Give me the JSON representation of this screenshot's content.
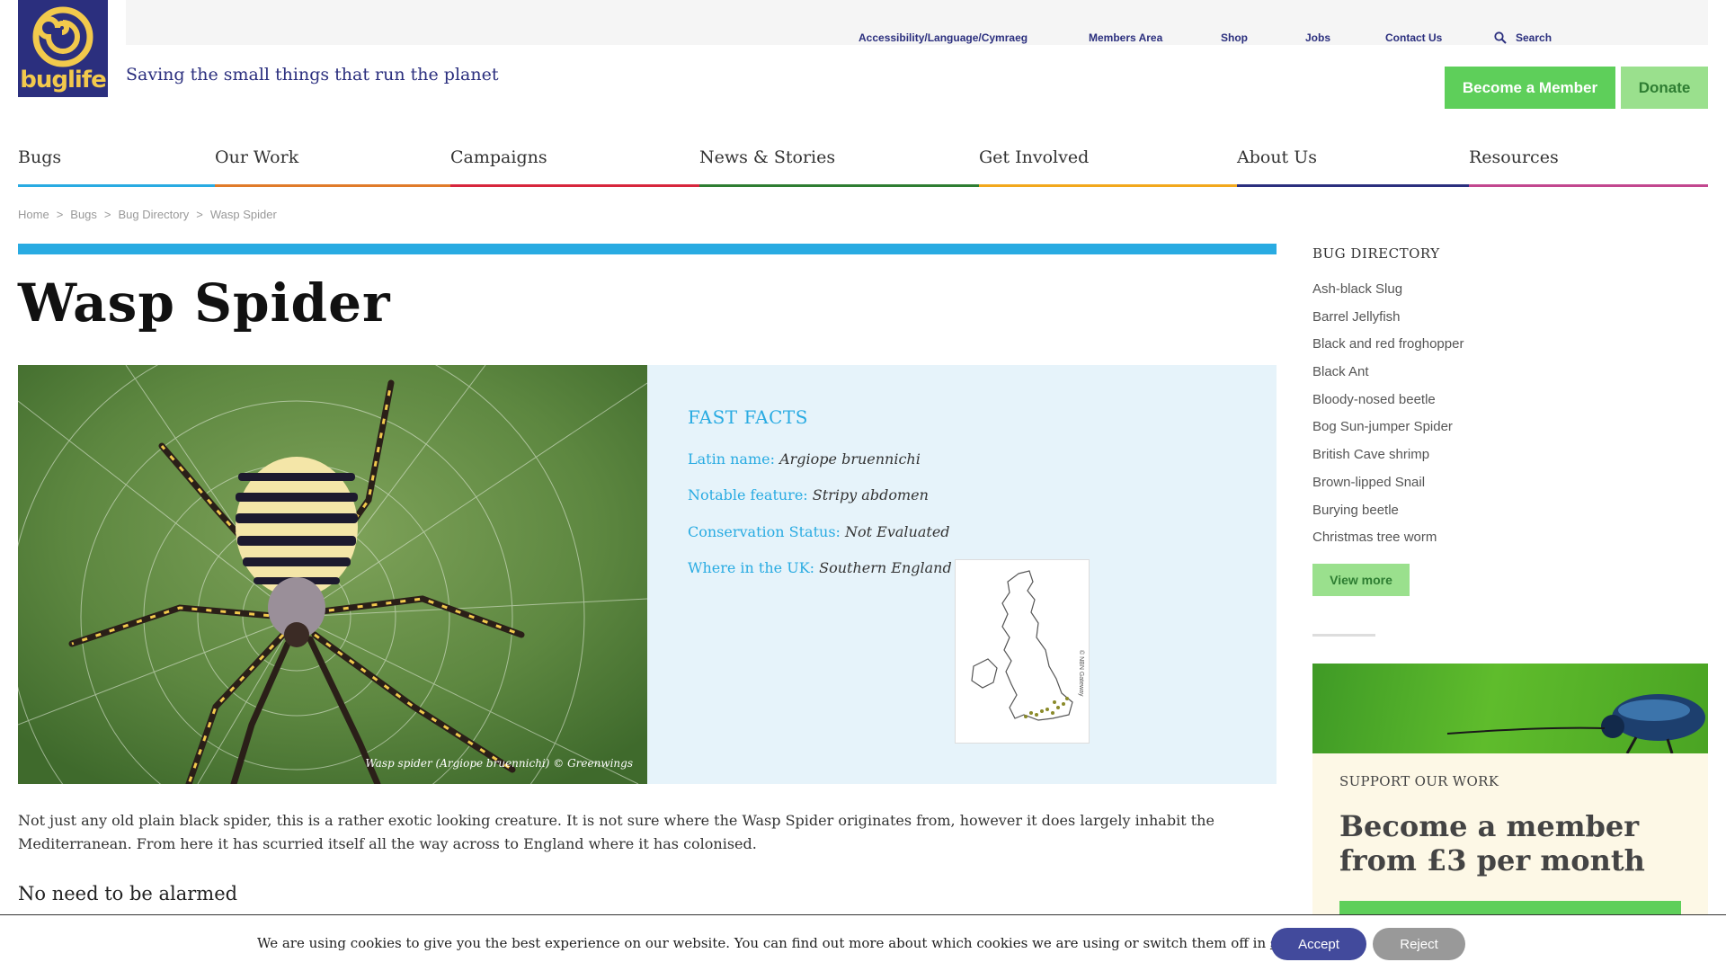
{
  "logo": {
    "text": "buglife",
    "icon": "spiral-logo-icon"
  },
  "utility_nav": {
    "accessibility": "Accessibility/Language/Cymraeg",
    "members": "Members Area",
    "shop": "Shop",
    "jobs": "Jobs",
    "contact": "Contact Us",
    "search": "Search",
    "search_icon": "search-icon"
  },
  "tagline": "Saving the small things that run the planet",
  "header_buttons": {
    "member": "Become a Member",
    "donate": "Donate"
  },
  "main_nav": [
    {
      "label": "Bugs",
      "color": "#29abe2"
    },
    {
      "label": "Our Work",
      "color": "#e07b2a"
    },
    {
      "label": "Campaigns",
      "color": "#d7263d"
    },
    {
      "label": "News & Stories",
      "color": "#2e7d32"
    },
    {
      "label": "Get Involved",
      "color": "#f2a81d"
    },
    {
      "label": "About Us",
      "color": "#2b2f7e"
    },
    {
      "label": "Resources",
      "color": "#c2478f"
    }
  ],
  "breadcrumb": [
    "Home",
    "Bugs",
    "Bug Directory",
    "Wasp Spider"
  ],
  "page": {
    "title": "Wasp Spider",
    "photo_caption": "Wasp spider (Argiope bruennichi) © Greenwings",
    "facts_title": "FAST FACTS",
    "facts": [
      {
        "label": "Latin name:",
        "value": "Argiope bruennichi"
      },
      {
        "label": "Notable feature:",
        "value": "Stripy abdomen"
      },
      {
        "label": "Conservation Status:",
        "value": "Not Evaluated"
      },
      {
        "label": "Where in the UK:",
        "value": "Southern England"
      }
    ],
    "map_credit": "© NBN Gateway",
    "intro": "Not just any old plain black spider, this is a rather exotic looking creature. It is not sure where the Wasp Spider originates from, however it does largely inhabit the Mediterranean. From here it has scurried itself all the way across to England where it has colonised.",
    "subheading": "No need to be alarmed"
  },
  "sidebar": {
    "directory_title": "BUG DIRECTORY",
    "directory": [
      "Ash-black Slug",
      "Barrel Jellyfish",
      "Black and red froghopper",
      "Black Ant",
      "Bloody-nosed beetle",
      "Bog Sun-jumper Spider",
      "British Cave shrimp",
      "Brown-lipped Snail",
      "Burying beetle",
      "Christmas tree worm"
    ],
    "view_more": "View more",
    "support_kicker": "SUPPORT OUR WORK",
    "support_head_line1": "Become a member",
    "support_head_line2": "from £3 per month"
  },
  "cookie": {
    "text": "We are using cookies to give you the best experience on our website. You can find out more about which cookies we are using or switch them off in ",
    "link": "settings",
    "end": ".",
    "accept": "Accept",
    "reject": "Reject"
  }
}
